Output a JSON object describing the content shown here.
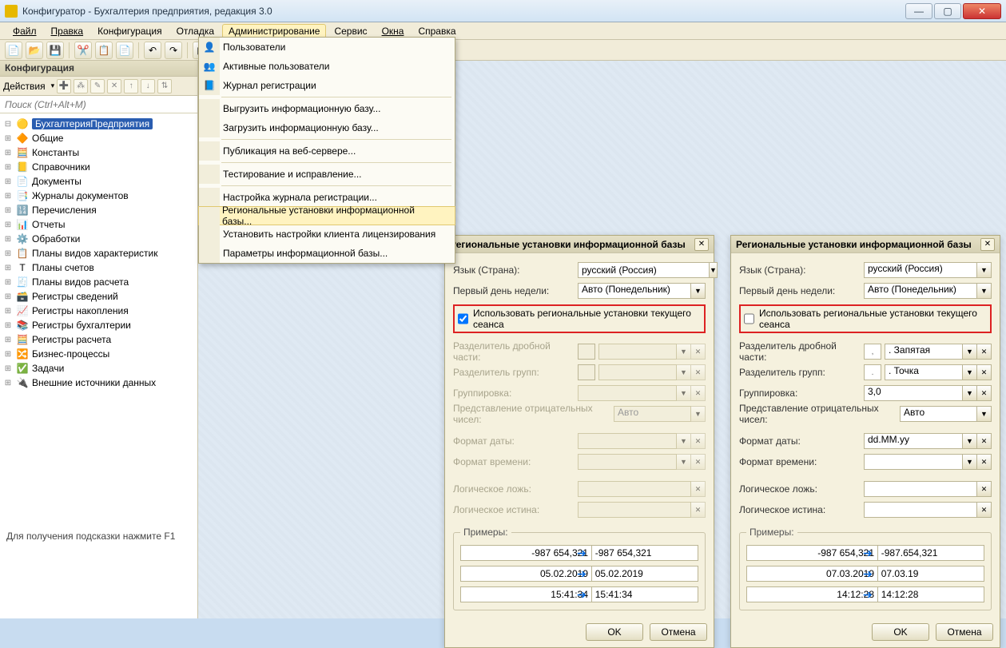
{
  "window": {
    "title": "Конфигуратор - Бухгалтерия предприятия, редакция 3.0"
  },
  "menu": {
    "items": [
      "Файл",
      "Правка",
      "Конфигурация",
      "Отладка",
      "Администрирование",
      "Сервис",
      "Окна",
      "Справка"
    ],
    "active_index": 4
  },
  "dropdown": {
    "items": [
      {
        "label": "Пользователи",
        "icon": "👤"
      },
      {
        "label": "Активные пользователи",
        "icon": "👥"
      },
      {
        "label": "Журнал регистрации",
        "icon": "📘"
      },
      {
        "sep": true
      },
      {
        "label": "Выгрузить информационную базу..."
      },
      {
        "label": "Загрузить информационную базу..."
      },
      {
        "sep": true
      },
      {
        "label": "Публикация на веб-сервере..."
      },
      {
        "sep": true
      },
      {
        "label": "Тестирование и исправление..."
      },
      {
        "sep": true
      },
      {
        "label": "Настройка журнала регистрации..."
      },
      {
        "label": "Региональные установки информационной базы...",
        "selected": true
      },
      {
        "label": "Установить настройки клиента лицензирования"
      },
      {
        "label": "Параметры информационной базы..."
      }
    ]
  },
  "sidebar": {
    "header": "Конфигурация",
    "actions_label": "Действия",
    "search_placeholder": "Поиск (Ctrl+Alt+M)",
    "root": "БухгалтерияПредприятия",
    "nodes": [
      {
        "icon": "🔶",
        "label": "Общие"
      },
      {
        "icon": "🧮",
        "label": "Константы"
      },
      {
        "icon": "📒",
        "label": "Справочники"
      },
      {
        "icon": "📄",
        "label": "Документы"
      },
      {
        "icon": "📑",
        "label": "Журналы документов"
      },
      {
        "icon": "🔢",
        "label": "Перечисления"
      },
      {
        "icon": "📊",
        "label": "Отчеты"
      },
      {
        "icon": "⚙️",
        "label": "Обработки"
      },
      {
        "icon": "📋",
        "label": "Планы видов характеристик"
      },
      {
        "icon": "Т",
        "label": "Планы счетов"
      },
      {
        "icon": "🧾",
        "label": "Планы видов расчета"
      },
      {
        "icon": "🗃️",
        "label": "Регистры сведений"
      },
      {
        "icon": "📈",
        "label": "Регистры накопления"
      },
      {
        "icon": "📚",
        "label": "Регистры бухгалтерии"
      },
      {
        "icon": "🧮",
        "label": "Регистры расчета"
      },
      {
        "icon": "🔀",
        "label": "Бизнес-процессы"
      },
      {
        "icon": "✅",
        "label": "Задачи"
      },
      {
        "icon": "🔌",
        "label": "Внешние источники данных"
      }
    ]
  },
  "statusbar": "Для получения подсказки нажмите F1",
  "dialog_shared": {
    "title": "Региональные установки информационной базы",
    "lbl_lang": "Язык (Страна):",
    "lbl_firstday": "Первый день недели:",
    "lbl_usecurrent": "Использовать региональные установки текущего сеанса",
    "lbl_decsep": "Разделитель дробной части:",
    "lbl_grpsep": "Разделитель групп:",
    "lbl_grouping": "Группировка:",
    "lbl_neg": "Представление отрицательных чисел:",
    "lbl_datefmt": "Формат даты:",
    "lbl_timefmt": "Формат времени:",
    "lbl_boolfalse": "Логическое ложь:",
    "lbl_booltrue": "Логическое истина:",
    "lbl_examples": "Примеры:",
    "val_auto": "Авто",
    "btn_ok": "OK",
    "btn_cancel": "Отмена"
  },
  "dialog1": {
    "lang": "русский (Россия)",
    "firstday": "Авто (Понедельник)",
    "usecurrent": true,
    "ex_num_in": "-987 654,321",
    "ex_num_out": "-987 654,321",
    "ex_date_in": "05.02.2019",
    "ex_date_out": "05.02.2019",
    "ex_time_in": "15:41:34",
    "ex_time_out": "15:41:34"
  },
  "dialog2": {
    "lang": "русский (Россия)",
    "firstday": "Авто (Понедельник)",
    "usecurrent": false,
    "decsep": ". Запятая",
    "grpsep": ". Точка",
    "grouping": "3,0",
    "neg": "Авто",
    "datefmt": "dd.MM.yy",
    "ex_num_in": "-987 654,321",
    "ex_num_out": "-987.654,321",
    "ex_date_in": "07.03.2019",
    "ex_date_out": "07.03.19",
    "ex_time_in": "14:12:28",
    "ex_time_out": "14:12:28"
  }
}
